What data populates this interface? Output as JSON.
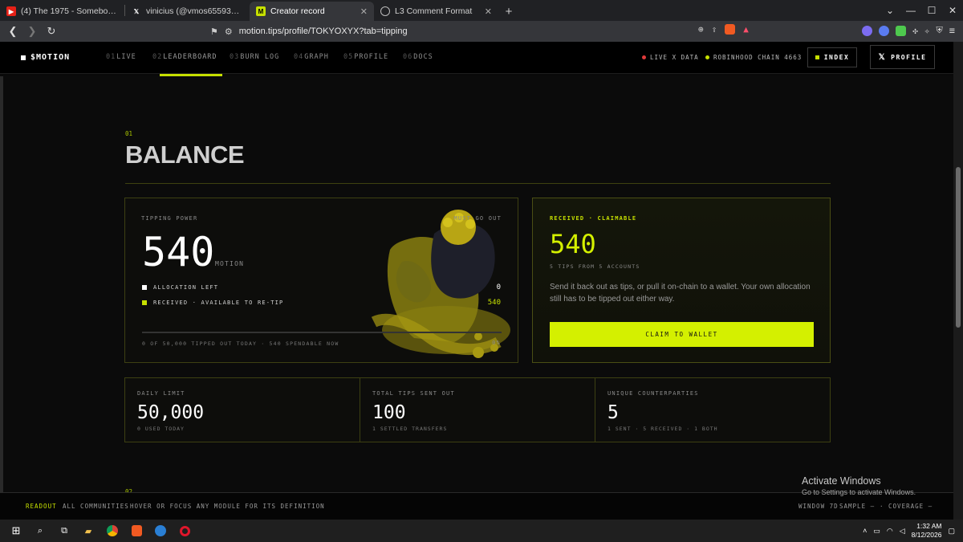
{
  "browser": {
    "tabs": [
      {
        "title": "(4) The 1975 - Somebody Else - (Vev",
        "icon": "youtube-icon",
        "active": false
      },
      {
        "title": "vinicius (@vmos655930) / X",
        "icon": "x-icon",
        "active": false
      },
      {
        "title": "Creator record",
        "icon": "motion-icon",
        "active": true
      },
      {
        "title": "L3 Comment Format",
        "icon": "globe-icon",
        "active": false
      }
    ],
    "url": "motion.tips/profile/TOKYOXYX?tab=tipping"
  },
  "header": {
    "brand": "$MOTION",
    "nav": [
      {
        "num": "01",
        "label": "LIVE"
      },
      {
        "num": "02",
        "label": "LEADERBOARD"
      },
      {
        "num": "03",
        "label": "BURN LOG"
      },
      {
        "num": "04",
        "label": "GRAPH"
      },
      {
        "num": "05",
        "label": "PROFILE"
      },
      {
        "num": "06",
        "label": "DOCS"
      }
    ],
    "live_status": "LIVE X DATA",
    "chain_status": "ROBINHOOD CHAIN 4663",
    "index_button": "INDEX",
    "profile_button": "PROFILE",
    "colors": {
      "accent": "#c6e000",
      "live": "#e03a3a"
    }
  },
  "balance": {
    "section_num": "01",
    "title": "BALANCE",
    "tipping": {
      "label": "TIPPING POWER",
      "corner_label": "MUST GO OUT",
      "amount": "540",
      "unit": "MOTION",
      "rows": [
        {
          "label": "ALLOCATION LEFT",
          "value": "0"
        },
        {
          "label": "RECEIVED · AVAILABLE TO RE-TIP",
          "value": "540"
        }
      ],
      "progress_fraction": 0,
      "footer_text": "0 OF 50,000 TIPPED OUT TODAY · 540 SPENDABLE NOW",
      "percent": "0%"
    },
    "claim": {
      "label": "RECEIVED · CLAIMABLE",
      "amount": "540",
      "sub": "5 TIPS FROM 5 ACCOUNTS",
      "desc": "Send it back out as tips, or pull it on-chain to a wallet. Your own allocation still has to be tipped out either way.",
      "button": "CLAIM TO WALLET"
    },
    "stats": [
      {
        "label": "DAILY LIMIT",
        "value": "50,000",
        "sub": "0 USED TODAY"
      },
      {
        "label": "TOTAL TIPS SENT OUT",
        "value": "100",
        "sub": "1 SETTLED TRANSFERS"
      },
      {
        "label": "UNIQUE COUNTERPARTIES",
        "value": "5",
        "sub": "1 SENT · 5 RECEIVED · 1 BOTH"
      }
    ]
  },
  "next_section_num": "02",
  "footer": {
    "readout": "READOUT",
    "communities": "ALL COMMUNITIES",
    "hint": "HOVER OR FOCUS ANY MODULE FOR ITS DEFINITION",
    "window": "WINDOW 7D",
    "sample": "SAMPLE —",
    "coverage": "· COVERAGE —"
  },
  "windows": {
    "activate_title": "Activate Windows",
    "activate_sub": "Go to Settings to activate Windows.",
    "time": "1:32 AM",
    "date": "8/12/2026"
  }
}
